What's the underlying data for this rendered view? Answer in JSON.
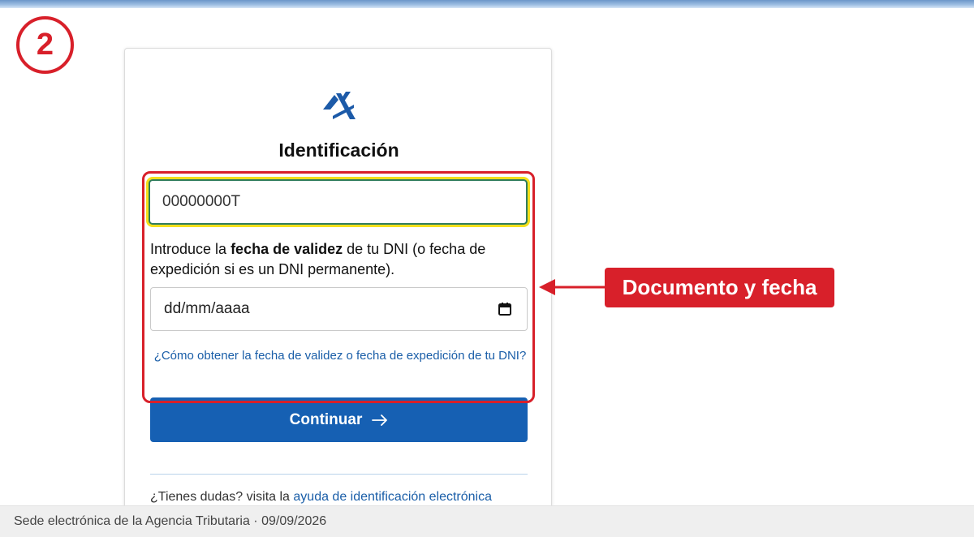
{
  "step": {
    "number": "2"
  },
  "card": {
    "logo_icon": "aeat-logo-icon",
    "title": "Identificación",
    "document_input": {
      "value": "00000000T"
    },
    "instructions": {
      "before": "Introduce la ",
      "bold": "fecha de validez",
      "after": " de tu DNI (o fecha de expedición si es un DNI permanente)."
    },
    "date_field": {
      "placeholder": "dd/mm/aaaa",
      "icon": "calendar-icon"
    },
    "help_link": "¿Cómo obtener la fecha de validez o fecha de expedición de tu DNI?",
    "continue_button": {
      "label": "Continuar",
      "icon": "arrow-right-icon"
    },
    "doubts": {
      "text": "¿Tienes dudas? visita la ",
      "link": "ayuda de identificación electrónica"
    }
  },
  "annotation": {
    "label": "Documento y fecha"
  },
  "footer": {
    "text": "Sede electrónica de la Agencia Tributaria · 09/09/2026"
  },
  "colors": {
    "accent_red": "#d8202a",
    "primary_blue": "#1660b3",
    "link_blue": "#1a5ea8",
    "focus_yellow": "#f4e01c"
  }
}
